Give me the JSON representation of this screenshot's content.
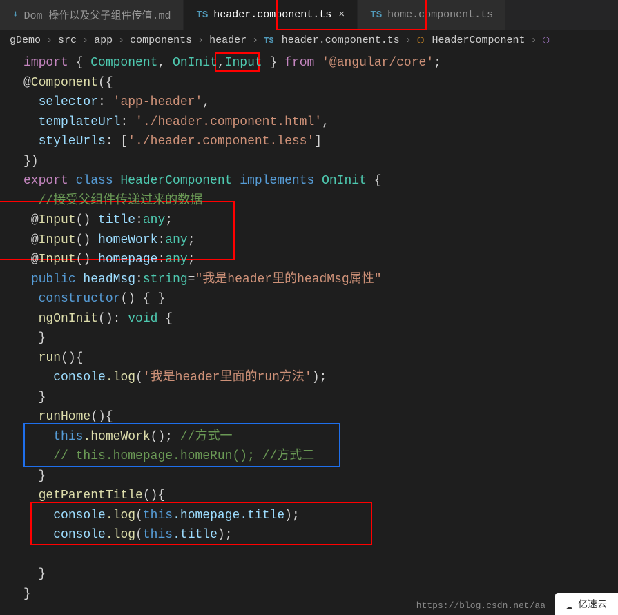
{
  "tabs": [
    {
      "icon": "⬇",
      "label": "Dom 操作以及父子组件传值.md"
    },
    {
      "icon": "TS",
      "label": "header.component.ts"
    },
    {
      "icon": "TS",
      "label": "home.component.ts"
    }
  ],
  "breadcrumbs": {
    "items": [
      "gDemo",
      "src",
      "app",
      "components",
      "header",
      "header.component.ts",
      "HeaderComponent"
    ]
  },
  "code": {
    "l1_import": "import",
    "l1_brace_o": " { ",
    "l1_component": "Component",
    "l1_c1": ", ",
    "l1_oninit": "OnInit",
    "l1_c2": ",",
    "l1_input": "Input",
    "l1_brace_c": " } ",
    "l1_from": "from",
    "l1_path": " '@angular/core'",
    "l1_semi": ";",
    "l2_at": "@",
    "l2_component": "Component",
    "l2_paren": "({",
    "l3_sel": "  selector",
    "l3_v": ": 'app-header',",
    "l3_str": "'app-header'",
    "l4_tpl": "  templateUrl",
    "l4_v": ": './header.component.html',",
    "l4_str": "'./header.component.html'",
    "l5_sty": "  styleUrls",
    "l5_v": ": ['./header.component.less']",
    "l5_str": "'./header.component.less'",
    "l6": "})",
    "l7_export": "export",
    "l7_class": " class",
    "l7_name": " HeaderComponent",
    "l7_impl": " implements",
    "l7_oninit": " OnInit",
    "l7_brace": " {",
    "l8_comment": "  //接受父组件传递过来的数据",
    "l9_at": "@",
    "l9_input": "Input",
    "l9_paren": "() ",
    "l9_title": "title",
    "l9_col": ":",
    "l9_any": "any",
    "l9_semi": ";",
    "l10_hw": "homeWork",
    "l11_hp": "homepage",
    "l12_public": "public",
    "l12_hm": " headMsg",
    "l12_col": ":",
    "l12_str": "string",
    "l12_eq": "=",
    "l12_val": "\"我是header里的headMsg属性\"",
    "l13_ctor": "  constructor",
    "l13_rest": "() { }",
    "l14_ng": "  ngOnInit",
    "l14_rest": "(): ",
    "l14_void": "void",
    "l14_brace": " {",
    "l15": "  }",
    "l16_run": "  run",
    "l16_rest": "(){",
    "l17_console": "console",
    "l17_log": ".log",
    "l17_str": "'我是header里面的run方法'",
    "l17_rest": "(",
    "l17_end": ");",
    "l18": "  }",
    "l19_runhome": "  runHome",
    "l19_rest": "(){",
    "l20_this": "this",
    "l20_hw": ".homeWork",
    "l20_rest": "(); ",
    "l20_comment": "//方式一",
    "l21_comment": "// this.homepage.homeRun(); //方式二",
    "l22": "  }",
    "l23_get": "  getParentTitle",
    "l23_rest": "(){",
    "l24_console": "console",
    "l24_log": ".log",
    "l24_p": "(",
    "l24_this": "this",
    "l24_hp": ".homepage",
    "l24_title": ".title",
    "l24_end": ");",
    "l25_title": ".title",
    "l26": "  }",
    "l27": "}"
  },
  "footer": {
    "url": "https://blog.csdn.net/aa",
    "watermark": "亿速云"
  }
}
